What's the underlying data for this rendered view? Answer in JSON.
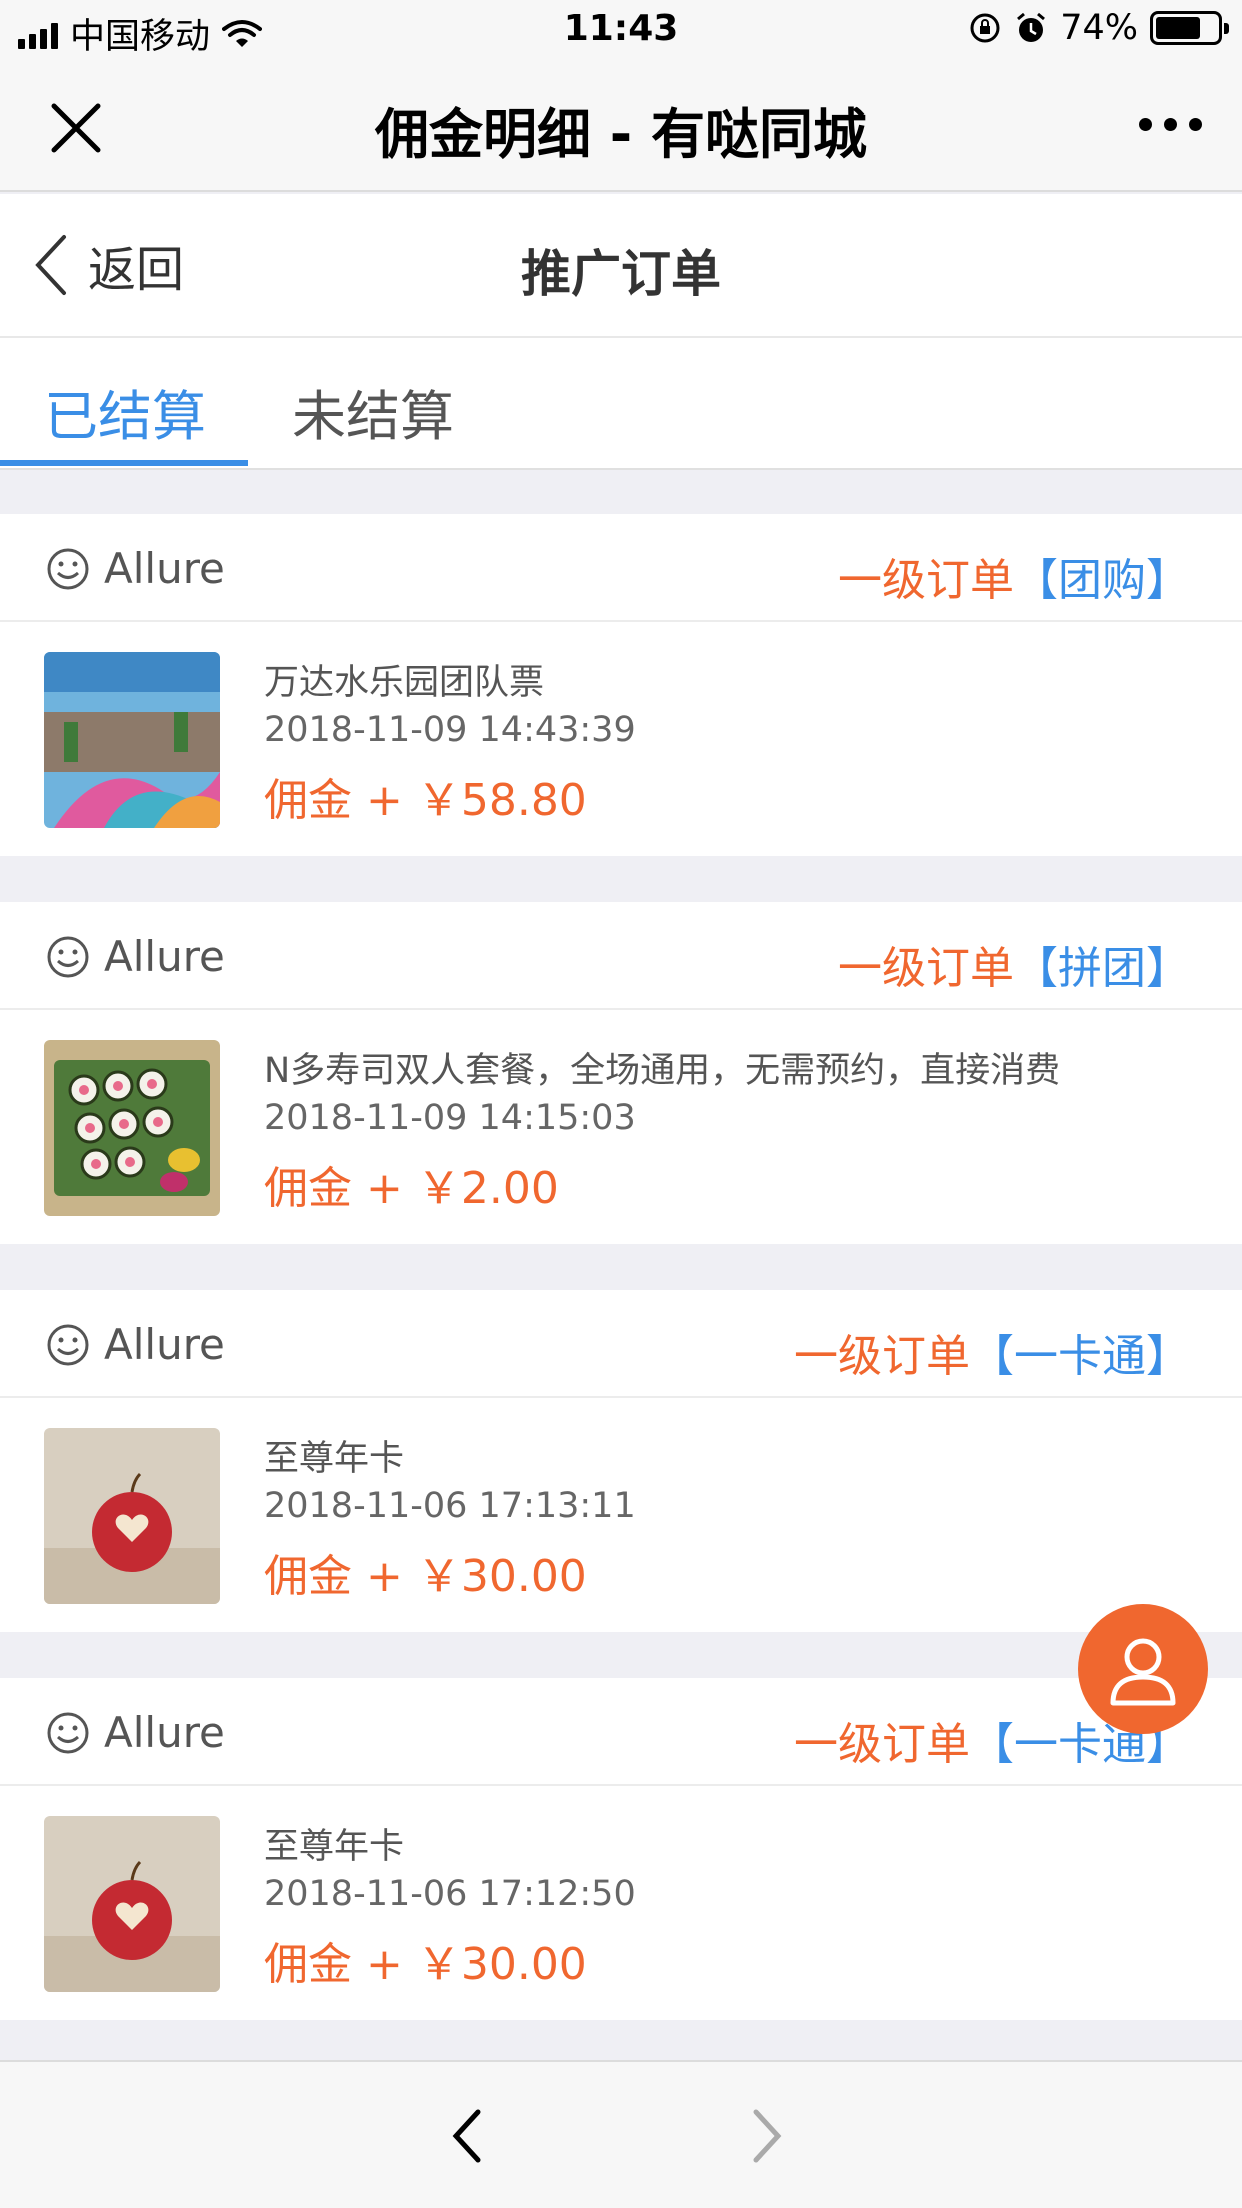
{
  "status_bar": {
    "carrier": "中国移动",
    "time": "11:43",
    "battery": "74%"
  },
  "nav": {
    "title": "佣金明细 - 有哒同城"
  },
  "header": {
    "back_label": "返回",
    "title": "推广订单"
  },
  "tabs": [
    {
      "label": "已结算"
    },
    {
      "label": "未结算"
    }
  ],
  "orders": [
    {
      "user": "Allure",
      "level": "一级订单",
      "category": "【团购】",
      "title": "万达水乐园团队票",
      "date": "2018-11-09 14:43:39",
      "commission": "佣金 + ￥58.80"
    },
    {
      "user": "Allure",
      "level": "一级订单",
      "category": "【拼团】",
      "title": "N多寿司双人套餐，全场通用，无需预约，直接消费",
      "date": "2018-11-09 14:15:03",
      "commission": "佣金 + ￥2.00"
    },
    {
      "user": "Allure",
      "level": "一级订单",
      "category": "【一卡通】",
      "title": "至尊年卡",
      "date": "2018-11-06 17:13:11",
      "commission": "佣金 + ￥30.00"
    },
    {
      "user": "Allure",
      "level": "一级订单",
      "category": "【一卡通】",
      "title": "至尊年卡",
      "date": "2018-11-06 17:12:50",
      "commission": "佣金 + ￥30.00"
    }
  ],
  "colors": {
    "accent": "#3a8ee6",
    "orange": "#f0672f"
  }
}
